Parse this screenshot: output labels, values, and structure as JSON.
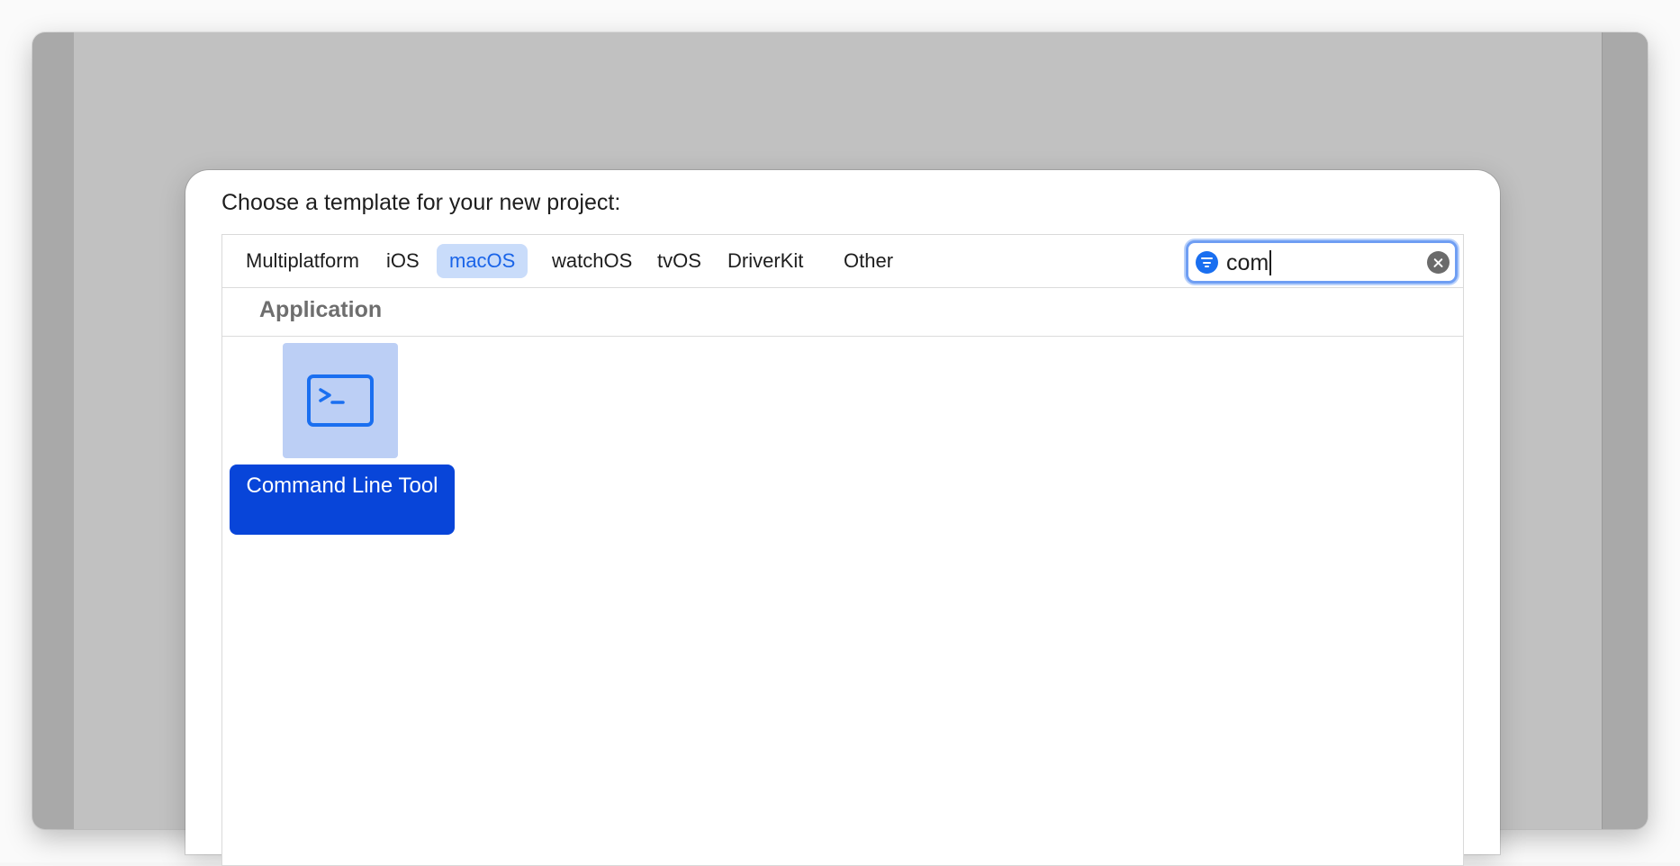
{
  "sheet": {
    "title": "Choose a template for your new project:"
  },
  "tabs": [
    {
      "label": "Multiplatform",
      "selected": false
    },
    {
      "label": "iOS",
      "selected": false
    },
    {
      "label": "macOS",
      "selected": true
    },
    {
      "label": "watchOS",
      "selected": false
    },
    {
      "label": "tvOS",
      "selected": false
    },
    {
      "label": "DriverKit",
      "selected": false
    },
    {
      "label": "Other",
      "selected": false
    }
  ],
  "search": {
    "value": "com",
    "filter_icon": "filter-icon",
    "clear_icon": "clear-icon"
  },
  "section": {
    "title": "Application"
  },
  "templates": [
    {
      "label": "Command Line Tool",
      "icon": "terminal-icon",
      "selected": true
    }
  ],
  "colors": {
    "accent": "#0845d9",
    "selected_tab_bg": "#c9dcfa",
    "selected_tab_text": "#1a64e8",
    "search_focus": "#6f9ef3"
  }
}
